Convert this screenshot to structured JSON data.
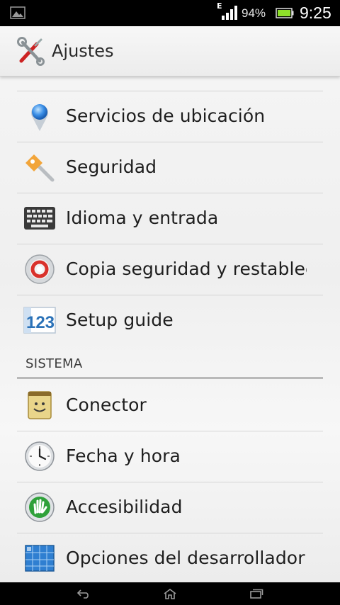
{
  "status_bar": {
    "network_type": "E",
    "battery_percent": "94%",
    "time": "9:25",
    "icons": [
      "image-notification-icon",
      "signal-icon",
      "battery-icon"
    ]
  },
  "header": {
    "title": "Ajustes",
    "icon": "settings-tools-icon"
  },
  "list": {
    "items_top": [
      {
        "label": "Servicios de ubicación",
        "icon": "location-icon"
      },
      {
        "label": "Seguridad",
        "icon": "key-icon"
      },
      {
        "label": "Idioma y entrada",
        "icon": "keyboard-icon"
      },
      {
        "label": "Copia seguridad y restablece",
        "icon": "backup-icon"
      },
      {
        "label": "Setup guide",
        "icon": "setup-guide-icon"
      }
    ],
    "section_title": "SISTEMA",
    "items_system": [
      {
        "label": "Conector",
        "icon": "connector-icon"
      },
      {
        "label": "Fecha y hora",
        "icon": "clock-icon"
      },
      {
        "label": "Accesibilidad",
        "icon": "accessibility-icon"
      },
      {
        "label": "Opciones del desarrollador",
        "icon": "developer-icon"
      }
    ]
  },
  "nav_bar": {
    "icons": [
      "back-icon",
      "home-icon",
      "recent-apps-icon"
    ]
  },
  "colors": {
    "status_bar_bg": "#000000",
    "list_bg": "#f2f2f2",
    "divider": "#d4d4d4",
    "text": "#1e1e1e",
    "battery_green": "#7ed321"
  }
}
